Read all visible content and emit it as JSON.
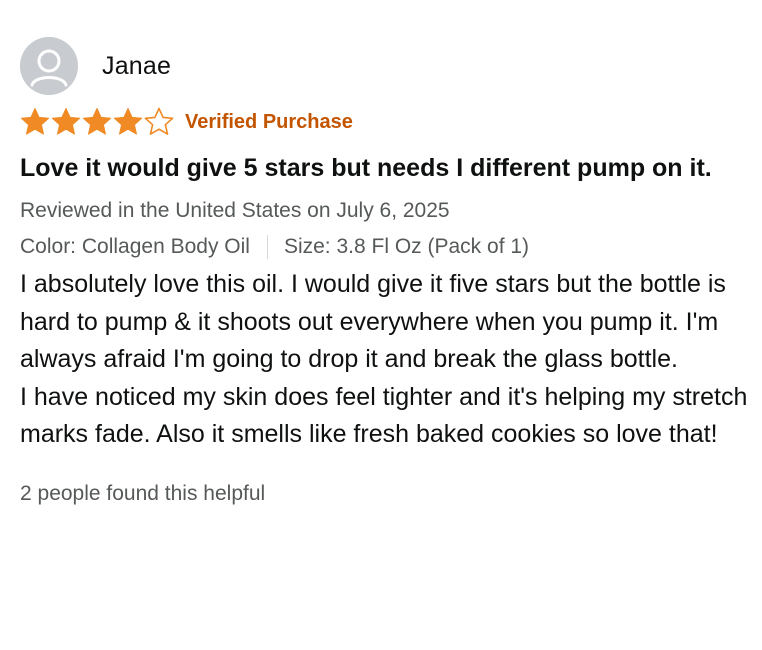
{
  "review": {
    "reviewer_name": "Janae",
    "avatar_icon": "user-avatar-icon",
    "rating": 4,
    "max_rating": 5,
    "star_color": "#f08a24",
    "verified_label": "Verified Purchase",
    "verified_color": "#c45500",
    "title": "Love it would give 5 stars but needs I different pump on it.",
    "date_text": "Reviewed in the United States on July 6, 2025",
    "color_variant": "Color: Collagen Body Oil",
    "size_variant": "Size: 3.8 Fl Oz (Pack of 1)",
    "body_paragraphs": [
      "I absolutely love this oil. I would give it five stars but the bottle is hard to pump & it shoots out everywhere when you pump it. I'm always afraid I'm going to drop it and break the glass bottle.",
      "I have noticed my skin does feel tighter and it's helping my stretch marks fade. Also it smells like fresh baked cookies so love that!"
    ],
    "helpful_text": "2 people found this helpful"
  }
}
